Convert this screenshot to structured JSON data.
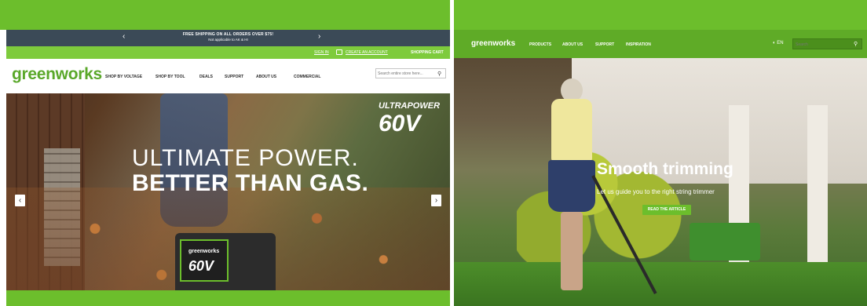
{
  "left": {
    "promo": {
      "line1": "FREE SHIPPING ON ALL ORDERS OVER $75!",
      "line2": "Not applicable to AK & HI",
      "prev_arrow": "‹",
      "next_arrow": "›"
    },
    "account": {
      "sign_in": "SIGN IN",
      "create": "CREATE AN ACCOUNT",
      "cart": "SHOPPING CART"
    },
    "logo": "greenworks",
    "nav": [
      "SHOP BY VOLTAGE",
      "SHOP BY TOOL",
      "DEALS",
      "SUPPORT",
      "ABOUT US",
      "COMMERCIAL"
    ],
    "search_placeholder": "Search entire store here...",
    "hero": {
      "headline_1": "ULTIMATE POWER.",
      "headline_2": "BETTER THAN GAS.",
      "ultrapower": "ULTRAPOWER",
      "voltage": "60V",
      "battery_brand": "greenworks",
      "battery_voltage": "60V"
    },
    "carousel_prev": "‹",
    "carousel_next": "›"
  },
  "right": {
    "logo": "greenworks",
    "nav": [
      "PRODUCTS",
      "ABOUT US",
      "SUPPORT",
      "INSPIRATION"
    ],
    "language": "EN",
    "search_placeholder": "Search",
    "hero": {
      "title": "Smooth trimming",
      "subtitle": "Let us guide you to the right string trimmer",
      "button": "READ THE ARTICLE"
    }
  },
  "colors": {
    "brand_green": "#6cbe2c",
    "promo_bar": "#3b4a57",
    "right_nav": "#5fab27"
  }
}
